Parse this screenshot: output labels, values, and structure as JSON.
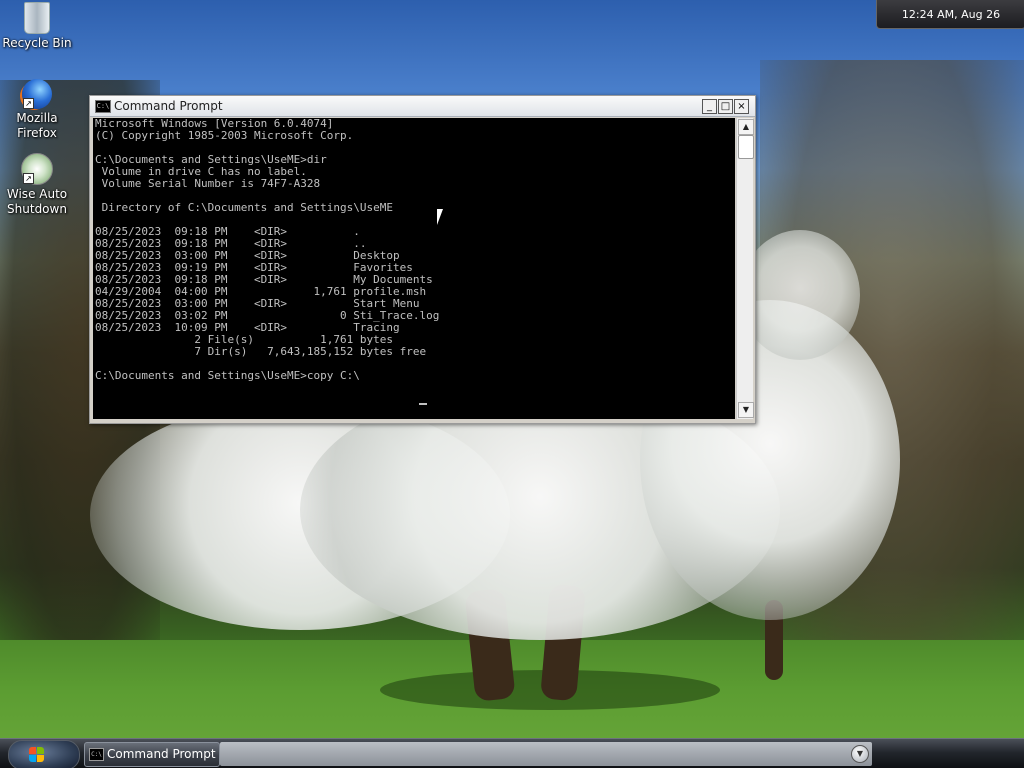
{
  "desktop": {
    "icons": [
      {
        "label": "Recycle Bin",
        "icon": "recycle-bin-icon"
      },
      {
        "label": "Mozilla Firefox",
        "icon": "firefox-icon"
      },
      {
        "label": "Wise Auto Shutdown",
        "icon": "wise-auto-shutdown-icon"
      }
    ]
  },
  "clock": {
    "text": "12:24 AM, Aug 26"
  },
  "window": {
    "title": "Command Prompt",
    "icon_text": "C:\\",
    "buttons": {
      "minimize": "_",
      "maximize": "□",
      "close": "×"
    },
    "console_lines": [
      "Microsoft Windows [Version 6.0.4074]",
      "(C) Copyright 1985-2003 Microsoft Corp.",
      "",
      "C:\\Documents and Settings\\UseME>dir",
      " Volume in drive C has no label.",
      " Volume Serial Number is 74F7-A328",
      "",
      " Directory of C:\\Documents and Settings\\UseME",
      "",
      "08/25/2023  09:18 PM    <DIR>          .",
      "08/25/2023  09:18 PM    <DIR>          ..",
      "08/25/2023  03:00 PM    <DIR>          Desktop",
      "08/25/2023  09:19 PM    <DIR>          Favorites",
      "08/25/2023  09:18 PM    <DIR>          My Documents",
      "04/29/2004  04:00 PM             1,761 profile.msh",
      "08/25/2023  03:00 PM    <DIR>          Start Menu",
      "08/25/2023  03:02 PM                 0 Sti_Trace.log",
      "08/25/2023  10:09 PM    <DIR>          Tracing",
      "               2 File(s)          1,761 bytes",
      "               7 Dir(s)   7,643,185,152 bytes free",
      "",
      "C:\\Documents and Settings\\UseME>copy C:\\"
    ]
  },
  "taskbar": {
    "task_label": "Command Prompt",
    "task_icon_text": "C:\\"
  }
}
